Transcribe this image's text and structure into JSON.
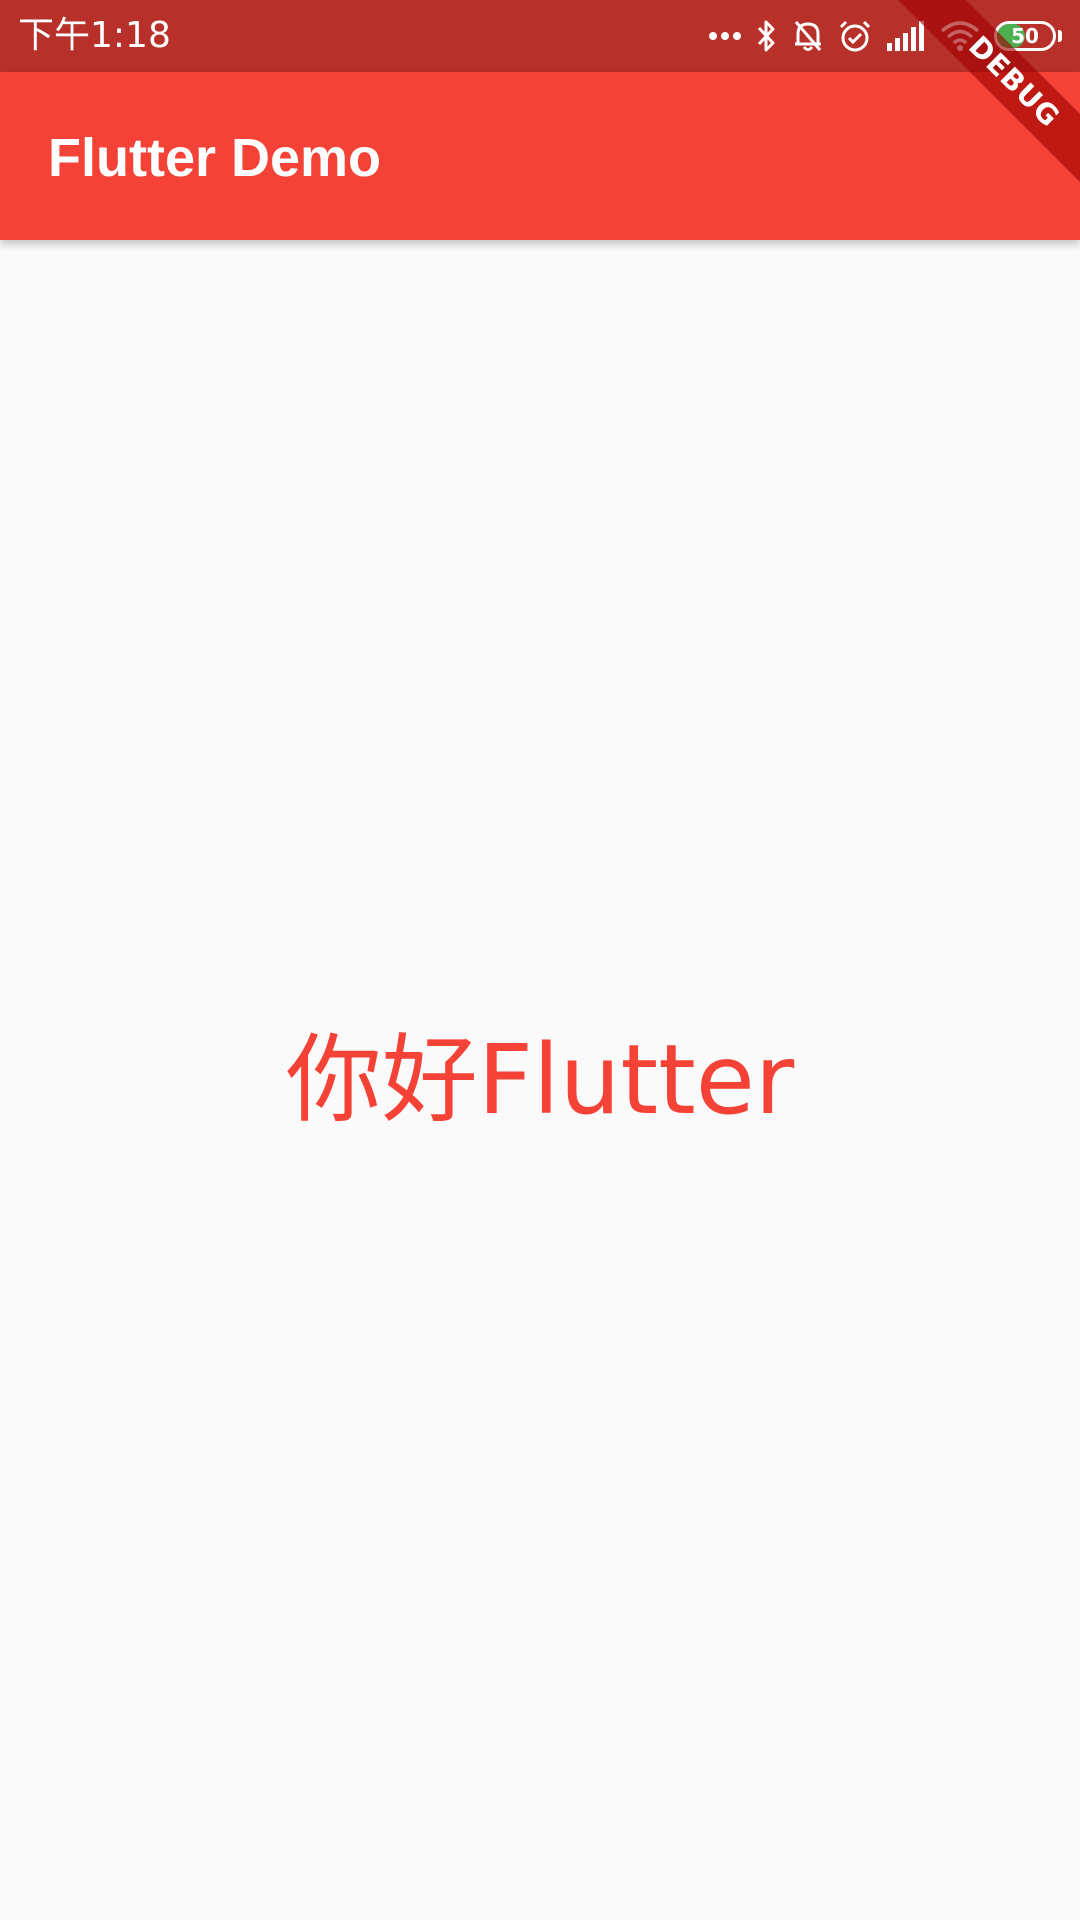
{
  "status_bar": {
    "time": "下午1:18",
    "icons": [
      "more-dots-icon",
      "bluetooth-icon",
      "bell-off-icon",
      "alarm-icon",
      "signal-icon",
      "wifi-icon",
      "battery-icon"
    ],
    "battery": {
      "level": "50",
      "fill_fraction": 0.5,
      "fill_color": "#4caf50"
    }
  },
  "app_bar": {
    "title": "Flutter Demo"
  },
  "debug_banner": {
    "label": "DEBUG"
  },
  "main": {
    "text": "你好Flutter"
  },
  "colors": {
    "status_bar": "#b7312a",
    "app_bar": "#f44336",
    "background": "#fafafa",
    "text_accent": "#f44336"
  }
}
